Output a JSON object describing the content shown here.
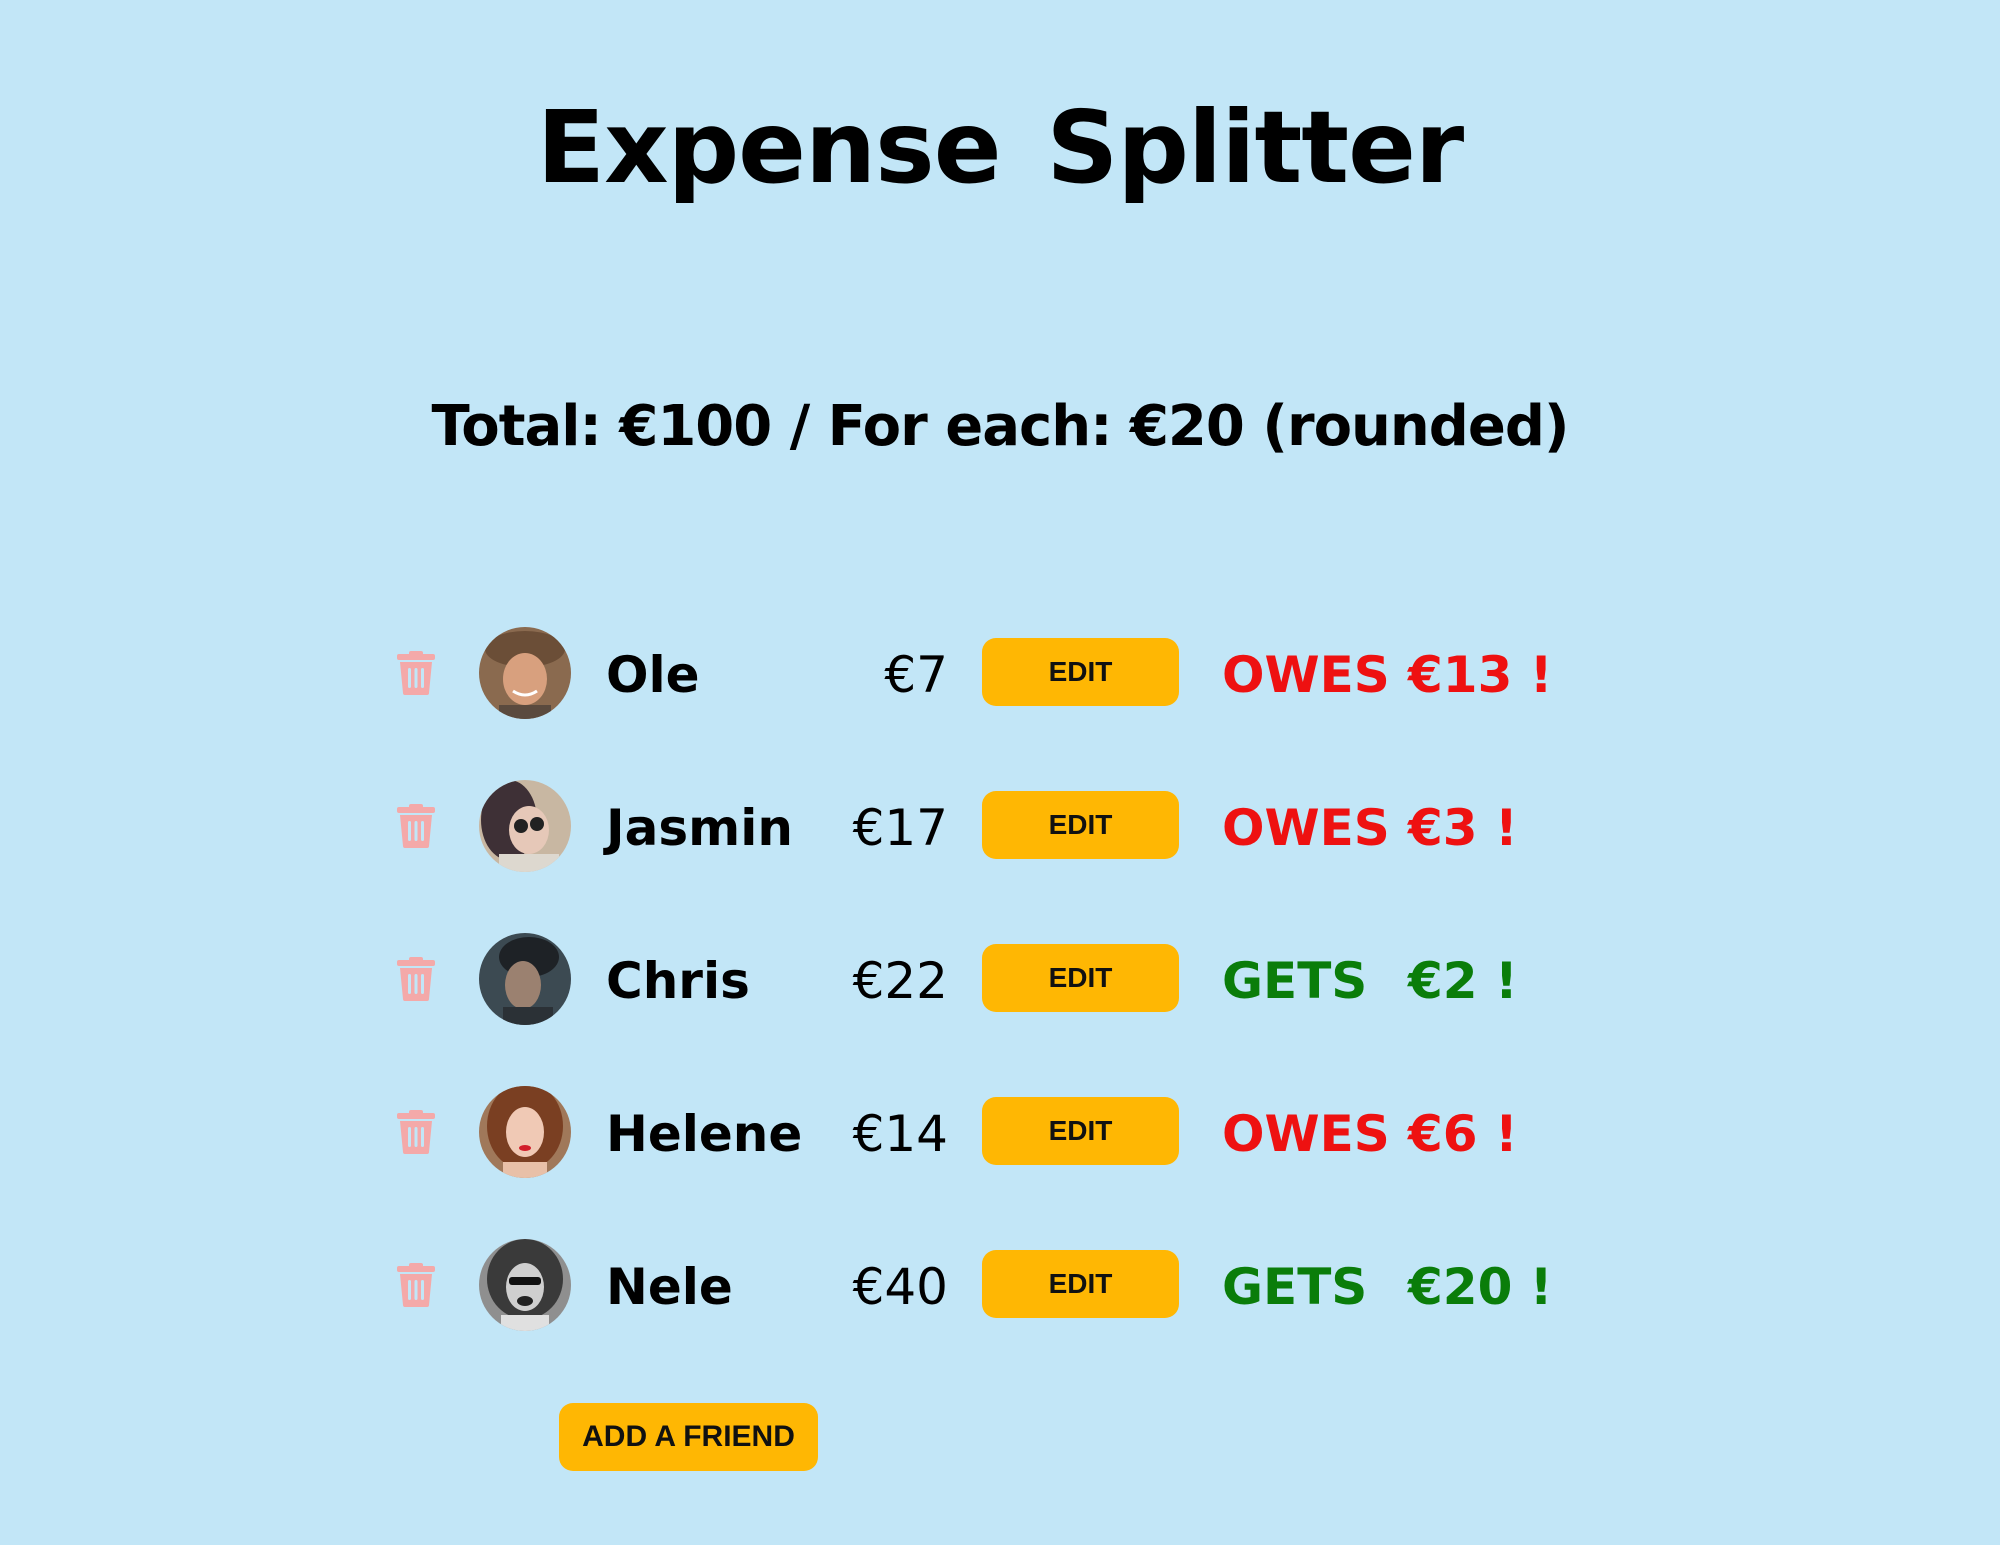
{
  "app": {
    "title": "Expense  Splitter"
  },
  "summary": {
    "text": "Total: €100 / For each: €20 (rounded)"
  },
  "friends": [
    {
      "name": "Ole",
      "amount": "€7",
      "edit_label": "EDIT",
      "status": "OWES",
      "balance": "€13 !",
      "status_color": "#ee1111"
    },
    {
      "name": "Jasmin",
      "amount": "€17",
      "edit_label": "EDIT",
      "status": "OWES",
      "balance": "€3 !",
      "status_color": "#ee1111"
    },
    {
      "name": "Chris",
      "amount": "€22",
      "edit_label": "EDIT",
      "status": "GETS",
      "balance": "€2 !",
      "status_color": "#0a7d0a"
    },
    {
      "name": "Helene",
      "amount": "€14",
      "edit_label": "EDIT",
      "status": "OWES",
      "balance": "€6 !",
      "status_color": "#ee1111"
    },
    {
      "name": "Nele",
      "amount": "€40",
      "edit_label": "EDIT",
      "status": "GETS",
      "balance": "€20 !",
      "status_color": "#0a7d0a"
    }
  ],
  "actions": {
    "add_friend_label": "ADD A FRIEND"
  },
  "icons": {
    "delete": "trash-icon",
    "avatar": "avatar-photo"
  },
  "colors": {
    "background": "#c2e6f7",
    "button": "#ffb703",
    "owes": "#ee1111",
    "gets": "#0a7d0a",
    "trash": "#f4a9a9"
  }
}
